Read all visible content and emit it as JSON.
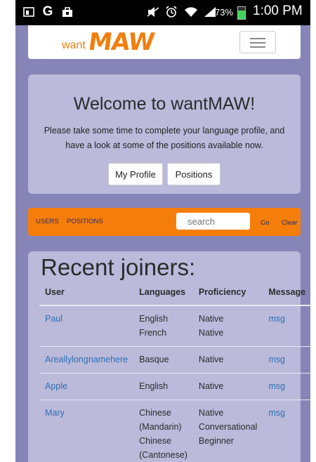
{
  "status_bar": {
    "battery_percent": "73%",
    "battery_level": 0.73,
    "time": "1:00 PM"
  },
  "header": {
    "logo_small": "want",
    "logo_big": "MAW"
  },
  "welcome": {
    "title": "Welcome to wantMAW!",
    "text": "Please take some time to complete your language profile, and have a look at some of the positions available now.",
    "buttons": {
      "profile": "My Profile",
      "positions": "Positions"
    }
  },
  "nav": {
    "users": "USERS",
    "positions": "POSITIONS",
    "search_placeholder": "search",
    "go": "Go",
    "clear": "Clear"
  },
  "joiners": {
    "title": "Recent joiners:",
    "headers": {
      "user": "User",
      "languages": "Languages",
      "proficiency": "Proficiency",
      "message": "Message"
    },
    "rows": [
      {
        "user": "Paul",
        "languages": [
          "English",
          "French"
        ],
        "proficiency": [
          "Native",
          "Native"
        ],
        "message": "msg"
      },
      {
        "user": "Areallylongnamehere",
        "languages": [
          "Basque"
        ],
        "proficiency": [
          "Native"
        ],
        "message": "msg"
      },
      {
        "user": "Apple",
        "languages": [
          "English"
        ],
        "proficiency": [
          "Native"
        ],
        "message": "msg"
      },
      {
        "user": "Mary",
        "languages": [
          "Chinese (Mandarin)",
          "Chinese (Cantonese)"
        ],
        "proficiency": [
          "Native",
          "Conversational",
          "Beginner"
        ],
        "message": "msg"
      }
    ]
  }
}
